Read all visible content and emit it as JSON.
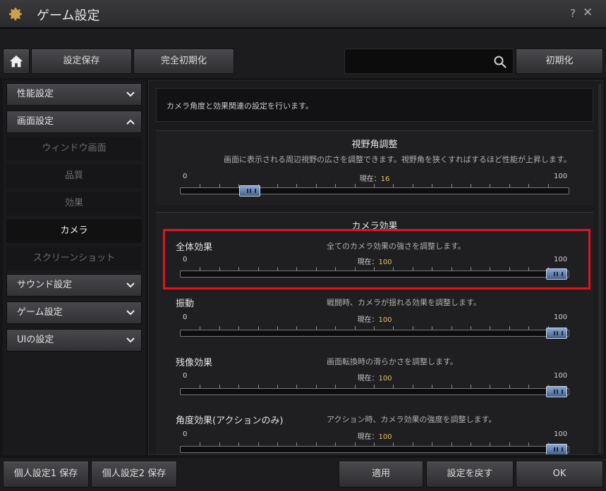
{
  "window": {
    "title": "ゲーム設定",
    "help": "?",
    "close": "✕"
  },
  "toolbar": {
    "save_label": "設定保存",
    "reset_all_label": "完全初期化",
    "search_value": "",
    "search_placeholder": "",
    "init_label": "初期化"
  },
  "sidebar": {
    "categories": [
      {
        "label": "性能設定",
        "expanded": false
      },
      {
        "label": "画面設定",
        "expanded": true
      },
      {
        "label": "サウンド設定",
        "expanded": false
      },
      {
        "label": "ゲーム設定",
        "expanded": false
      },
      {
        "label": "UIの設定",
        "expanded": false
      }
    ],
    "sub_items": [
      {
        "label": "ウィンドウ画面",
        "active": false
      },
      {
        "label": "品質",
        "active": false
      },
      {
        "label": "効果",
        "active": false
      },
      {
        "label": "カメラ",
        "active": true
      },
      {
        "label": "スクリーンショット",
        "active": false
      }
    ]
  },
  "main": {
    "description": "カメラ角度と効果関連の設定を行います。",
    "fov": {
      "title": "視野角調整",
      "desc": "画面に表示される周辺視野の広さを調整できます。視野角を狭くすればするほど性能が上昇します。",
      "min": "0",
      "max": "100",
      "current_label": "現在：",
      "value": 16
    },
    "camera": {
      "title": "カメラ効果",
      "items": [
        {
          "label": "全体効果",
          "desc": "全てのカメラ効果の強さを調整します。",
          "min": "0",
          "max": "100",
          "current_label": "現在：",
          "value": 100
        },
        {
          "label": "振動",
          "desc": "戦闘時、カメラが揺れる効果を調整します。",
          "min": "0",
          "max": "100",
          "current_label": "現在：",
          "value": 100
        },
        {
          "label": "残像効果",
          "desc": "画面転換時の滑らかさを調整します。",
          "min": "0",
          "max": "100",
          "current_label": "現在：",
          "value": 100
        },
        {
          "label": "角度効果(アクションのみ)",
          "desc": "アクション時、カメラ効果の強度を調整します。",
          "min": "0",
          "max": "100",
          "current_label": "現在：",
          "value": 100
        }
      ]
    }
  },
  "footer": {
    "personal1": "個人設定1 保存",
    "personal2": "個人設定2 保存",
    "apply": "適用",
    "revert": "設定を戻す",
    "ok": "OK"
  },
  "colors": {
    "accent_value": "#e8c060",
    "highlight": "#e0141e",
    "knob": "#6a88b4"
  },
  "icons": {
    "gear": "gear-icon",
    "home": "home-icon",
    "search": "search-icon",
    "chevron_down": "chevron-down-icon",
    "chevron_up": "chevron-up-icon"
  }
}
